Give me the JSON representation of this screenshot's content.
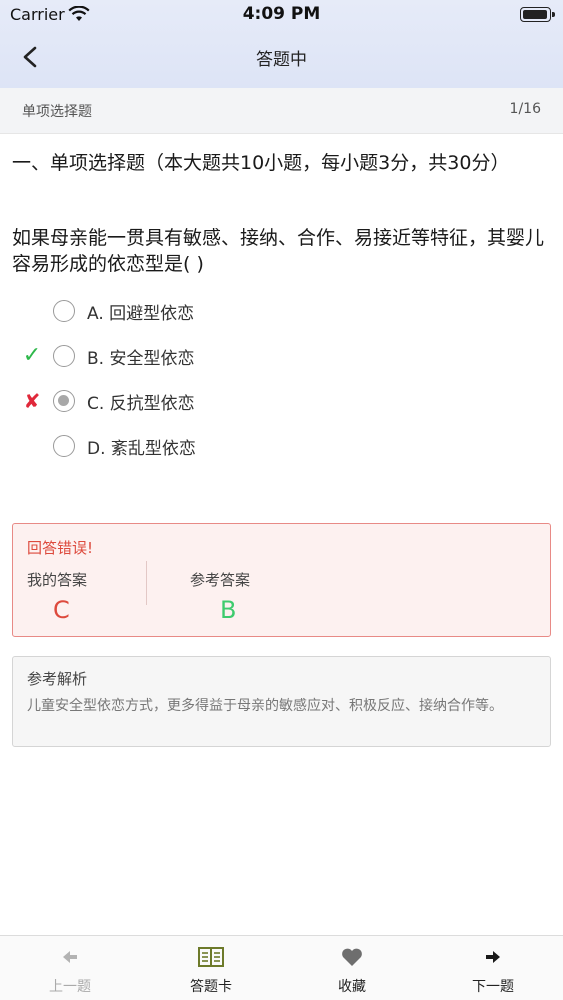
{
  "status_bar": {
    "carrier": "Carrier",
    "time": "4:09 PM"
  },
  "nav": {
    "title": "答题中"
  },
  "section": {
    "label": "单项选择题",
    "progress": "1/16"
  },
  "question": {
    "title": "一、单项选择题（本大题共10小题，每小题3分，共30分）",
    "stem": "如果母亲能一贯具有敏感、接纳、合作、易接近等特征，其婴儿容易形成的依恋型是(    )",
    "options": [
      {
        "label": "A. 回避型依恋",
        "mark": "",
        "selected": false
      },
      {
        "label": "B. 安全型依恋",
        "mark": "✓",
        "selected": false
      },
      {
        "label": "C. 反抗型依恋",
        "mark": "✘",
        "selected": true
      },
      {
        "label": "D. 紊乱型依恋",
        "mark": "",
        "selected": false
      }
    ]
  },
  "result": {
    "title": "回答错误!",
    "my_answer_label": "我的答案",
    "my_answer": "C",
    "reference_label": "参考答案",
    "reference_answer": "B",
    "colors": {
      "wrong": "#dd4a3d",
      "right": "#3ecb6e"
    }
  },
  "analysis": {
    "title": "参考解析",
    "text": "儿童安全型依恋方式，更多得益于母亲的敏感应对、积极反应、接纳合作等。"
  },
  "tabs": [
    {
      "label": "上一题",
      "icon": "arrow-left-icon",
      "disabled": true
    },
    {
      "label": "答题卡",
      "icon": "answer-card-icon",
      "disabled": false
    },
    {
      "label": "收藏",
      "icon": "heart-icon",
      "disabled": false
    },
    {
      "label": "下一题",
      "icon": "arrow-right-icon",
      "disabled": false
    }
  ]
}
